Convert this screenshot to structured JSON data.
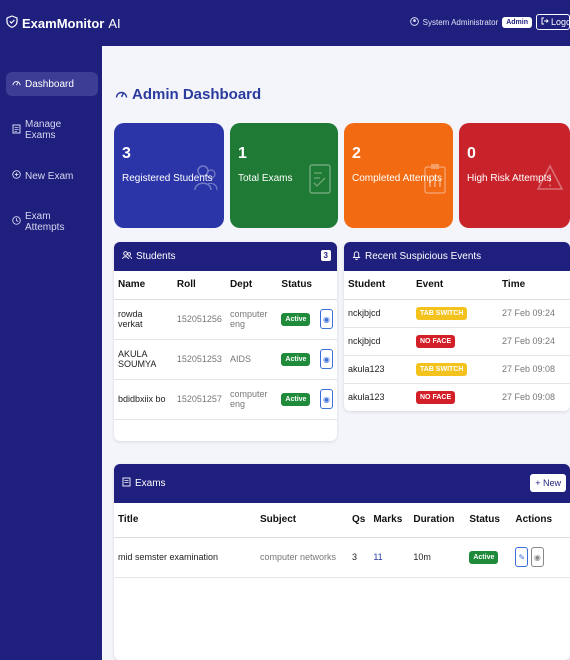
{
  "brand": {
    "name": "ExamMonitor",
    "suffix": "AI"
  },
  "user": {
    "name": "System Administrator",
    "role_badge": "Admin",
    "logout_label": "Logout"
  },
  "sidebar": {
    "items": [
      {
        "label": "Dashboard",
        "icon": "dashboard-icon",
        "active": true
      },
      {
        "label": "Manage Exams",
        "icon": "list-icon",
        "active": false
      },
      {
        "label": "New Exam",
        "icon": "plus-circle-icon",
        "active": false
      },
      {
        "label": "Exam Attempts",
        "icon": "history-icon",
        "active": false
      }
    ]
  },
  "page": {
    "title": "Admin Dashboard"
  },
  "stats": [
    {
      "value": "3",
      "label": "Registered Students",
      "color": "#2b35a8",
      "icon": "users-icon"
    },
    {
      "value": "1",
      "label": "Total Exams",
      "color": "#1e7a34",
      "icon": "checklist-icon"
    },
    {
      "value": "2",
      "label": "Completed Attempts",
      "color": "#f26a12",
      "icon": "clipboard-icon"
    },
    {
      "value": "0",
      "label": "High Risk Attempts",
      "color": "#c8232b",
      "icon": "warning-icon"
    }
  ],
  "students": {
    "title": "Students",
    "count": "3",
    "columns": [
      "Name",
      "Roll",
      "Dept",
      "Status"
    ],
    "rows": [
      {
        "name": "rowda verkat",
        "roll": "152051256",
        "dept": "computer eng",
        "status": "Active"
      },
      {
        "name": "AKULA SOUMYA",
        "roll": "152051253",
        "dept": "AIDS",
        "status": "Active"
      },
      {
        "name": "bdidbxiix bo",
        "roll": "152051257",
        "dept": "computer eng",
        "status": "Active"
      }
    ]
  },
  "events": {
    "title": "Recent Suspicious Events",
    "columns": [
      "Student",
      "Event",
      "Time"
    ],
    "rows": [
      {
        "student": "nckjbjcd",
        "event": "TAB SWITCH",
        "kind": "warn",
        "time": "27 Feb 09:24"
      },
      {
        "student": "nckjbjcd",
        "event": "NO FACE",
        "kind": "red",
        "time": "27 Feb 09:24"
      },
      {
        "student": "akula123",
        "event": "TAB SWITCH",
        "kind": "warn",
        "time": "27 Feb 09:08"
      },
      {
        "student": "akula123",
        "event": "NO FACE",
        "kind": "red",
        "time": "27 Feb 09:08"
      }
    ]
  },
  "exams": {
    "title": "Exams",
    "new_label": "+ New",
    "columns": [
      "Title",
      "Subject",
      "Qs",
      "Marks",
      "Duration",
      "Status",
      "Actions"
    ],
    "rows": [
      {
        "title": "mid semster examination",
        "subject": "computer networks",
        "qs": "3",
        "marks": "11",
        "duration": "10m",
        "status": "Active"
      }
    ]
  }
}
